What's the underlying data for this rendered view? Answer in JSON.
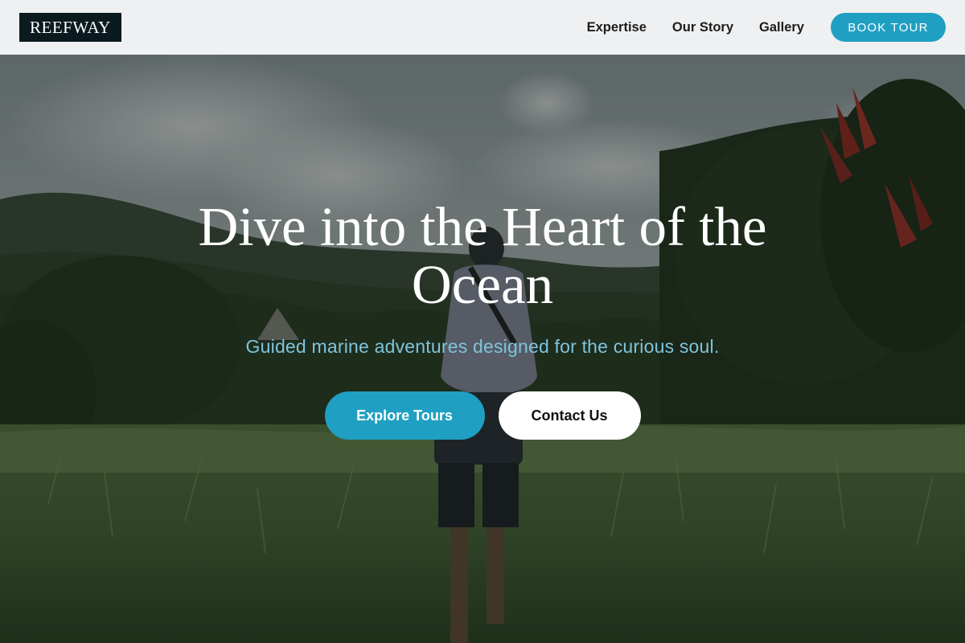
{
  "header": {
    "logo": "REEFWAY",
    "nav": [
      {
        "label": "Expertise"
      },
      {
        "label": "Our Story"
      },
      {
        "label": "Gallery"
      }
    ],
    "cta_label": "BOOK TOUR"
  },
  "hero": {
    "title": "Dive into the Heart of the Ocean",
    "subtitle": "Guided marine adventures designed for the curious soul.",
    "primary_button": "Explore Tours",
    "secondary_button": "Contact Us",
    "background_image": "person-walking-through-rice-field-photo"
  },
  "colors": {
    "accent": "#1fa0c2",
    "header_bg": "#eff0f1",
    "logo_bg": "#0b1a1e",
    "subtitle": "#7fc4dc"
  }
}
